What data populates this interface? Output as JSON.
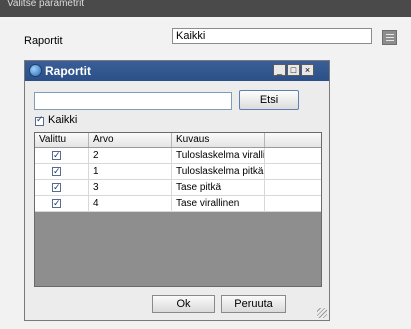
{
  "window": {
    "title": "Valitse parametrit"
  },
  "parameter": {
    "label": "Raportit",
    "value": "Kaikki",
    "menu_icon": "menu-icon"
  },
  "dialog": {
    "title": "Raportit",
    "icon": "globe-icon",
    "controls": {
      "minimize": "_",
      "maximize": "□",
      "close": "×"
    },
    "search": {
      "value": "",
      "button_label": "Etsi"
    },
    "select_all": {
      "label": "Kaikki",
      "checked": true
    },
    "table": {
      "columns": [
        "Valittu",
        "Arvo",
        "Kuvaus"
      ],
      "rows": [
        {
          "selected": true,
          "value": "2",
          "description": "Tuloslaskelma viralli..."
        },
        {
          "selected": true,
          "value": "1",
          "description": "Tuloslaskelma pitkä"
        },
        {
          "selected": true,
          "value": "3",
          "description": "Tase pitkä"
        },
        {
          "selected": true,
          "value": "4",
          "description": "Tase virallinen"
        }
      ]
    },
    "buttons": {
      "ok": "Ok",
      "cancel": "Peruuta"
    }
  }
}
